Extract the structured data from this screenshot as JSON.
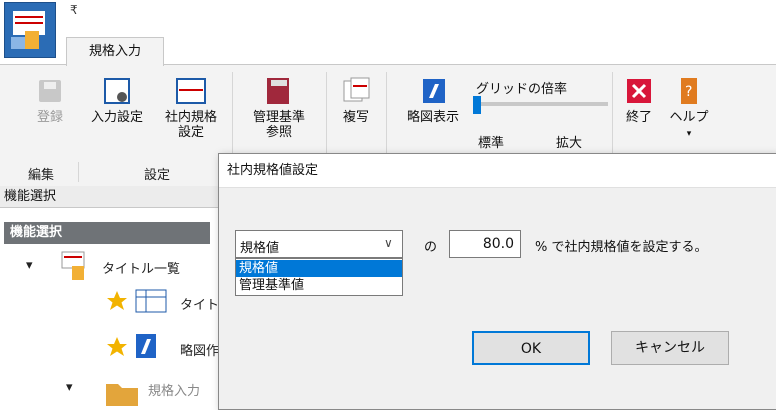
{
  "app": {
    "qat_symbol": "₹"
  },
  "tab": {
    "label": "規格入力"
  },
  "ribbon": {
    "buttons": [
      {
        "label1": "登録",
        "label2": "",
        "disabled": true
      },
      {
        "label1": "入力設定",
        "label2": ""
      },
      {
        "label1": "社内規格",
        "label2": "設定"
      },
      {
        "label1": "管理基準",
        "label2": "参照"
      },
      {
        "label1": "複写",
        "label2": ""
      },
      {
        "label1": "略図表示",
        "label2": ""
      },
      {
        "label1": "終了",
        "label2": ""
      },
      {
        "label1": "ヘルプ",
        "label2": "▾"
      }
    ],
    "groups": [
      "編集",
      "設定"
    ],
    "grid_zoom": {
      "title": "グリッドの倍率",
      "min_label": "標準",
      "max_label": "拡大",
      "level": 0
    }
  },
  "left_panel": {
    "header": "機能選択",
    "section_header": "機能選択",
    "tree": [
      {
        "label": "タイトル一覧"
      },
      {
        "label": "タイトル"
      },
      {
        "label": "略図作"
      },
      {
        "label": "規格入力"
      }
    ]
  },
  "dialog": {
    "title": "社内規格値設定",
    "select_value": "規格値",
    "options": [
      "規格値",
      "管理基準値"
    ],
    "no_text": "の",
    "rate_value": "80.0",
    "suffix": "% で社内規格値を設定する。",
    "ok_label": "OK",
    "cancel_label": "キャンセル"
  },
  "colors": {
    "accent": "#0078d7",
    "section_header_bg": "#6f7377"
  }
}
